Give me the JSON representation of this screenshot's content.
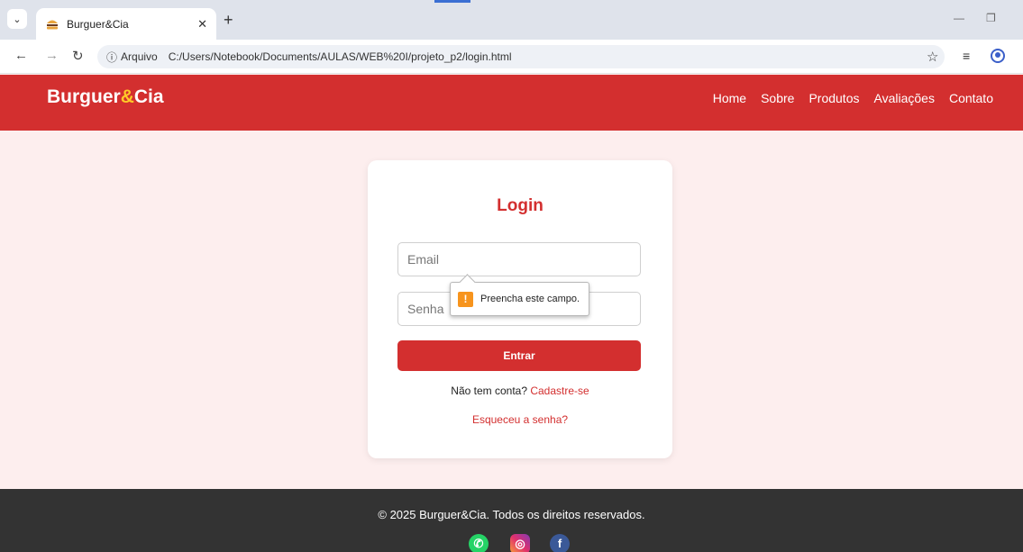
{
  "browser": {
    "tab_title": "Burguer&Cia",
    "info_label": "Arquivo",
    "url": "C:/Users/Notebook/Documents/AULAS/WEB%20I/projeto_p2/login.html"
  },
  "site": {
    "logo_main": "Burguer",
    "logo_amp": "&",
    "logo_end": "Cia",
    "nav": [
      "Home",
      "Sobre",
      "Produtos",
      "Avaliações",
      "Contato"
    ],
    "brand_color": "#d32f2f",
    "accent_color": "#ffca28"
  },
  "login": {
    "title": "Login",
    "email_placeholder": "Email",
    "password_placeholder": "Senha",
    "submit_label": "Entrar",
    "signup_prompt": "Não tem conta?",
    "signup_link": "Cadastre-se",
    "forgot_link": "Esqueceu a senha?"
  },
  "validation": {
    "message": "Preencha este campo."
  },
  "footer": {
    "copyright": "© 2025 Burguer&Cia. Todos os direitos reservados.",
    "social": [
      "whatsapp-icon",
      "instagram-icon",
      "facebook-icon"
    ]
  }
}
